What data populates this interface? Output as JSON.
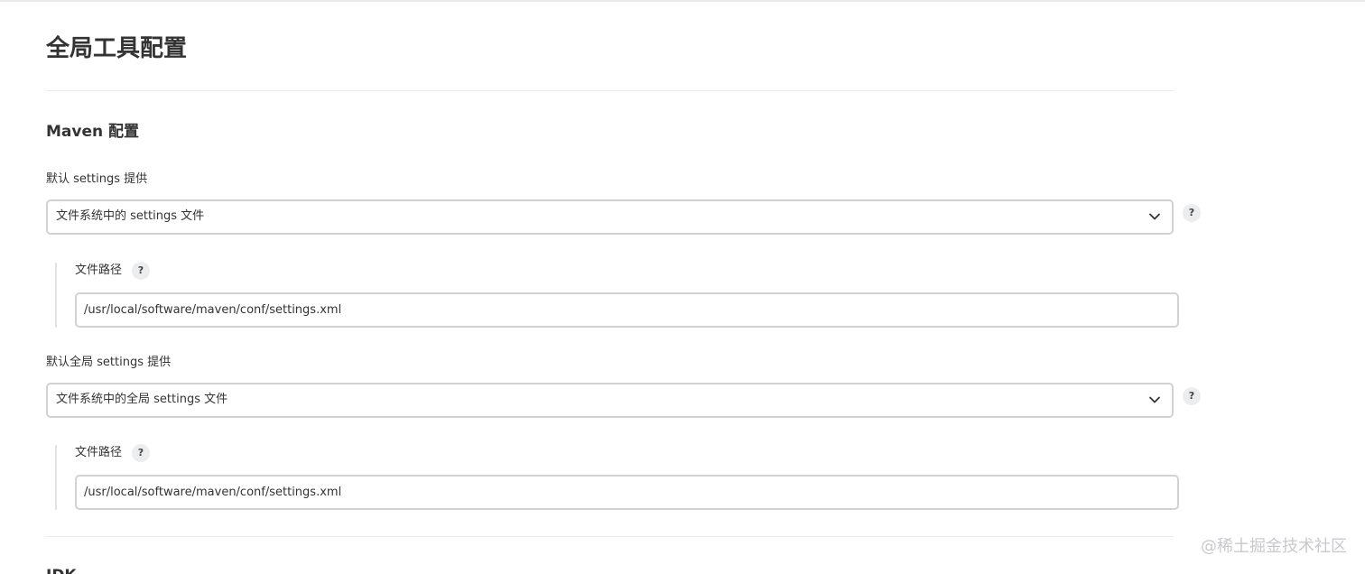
{
  "page": {
    "title": "全局工具配置"
  },
  "maven_section": {
    "title": "Maven 配置",
    "default_settings": {
      "label": "默认 settings 提供",
      "selected": "文件系统中的 settings 文件",
      "file_path_label": "文件路径",
      "file_path_value": "/usr/local/software/maven/conf/settings.xml"
    },
    "default_global_settings": {
      "label": "默认全局 settings 提供",
      "selected": "文件系统中的全局 settings 文件",
      "file_path_label": "文件路径",
      "file_path_value": "/usr/local/software/maven/conf/settings.xml"
    }
  },
  "next_section": {
    "title": "JDK"
  },
  "help_icon_glyph": "?",
  "watermark": "@稀土掘金技术社区",
  "icons": {
    "help": "help-icon",
    "chevron": "chevron-down-icon"
  },
  "colors": {
    "border": "#d0d2d6",
    "help_bg": "#ecedef",
    "text": "#333333"
  }
}
